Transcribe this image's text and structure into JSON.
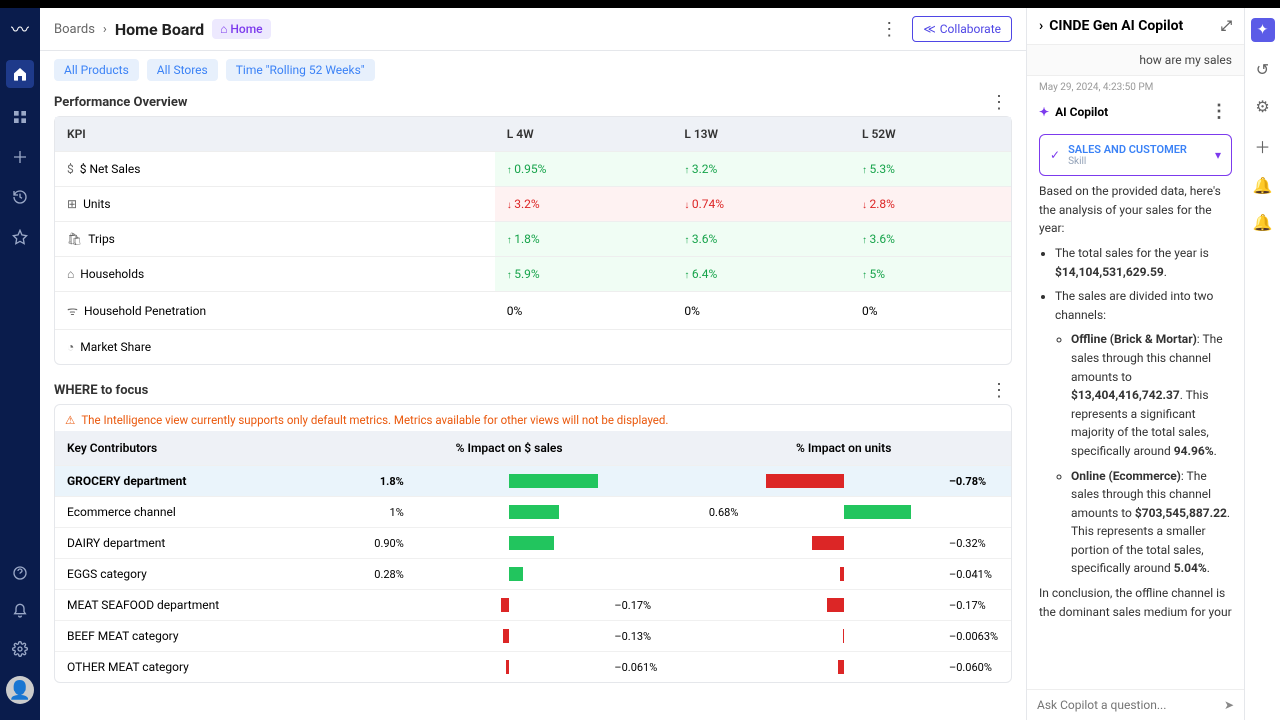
{
  "breadcrumb": {
    "root": "Boards",
    "title": "Home Board",
    "badge": "Home"
  },
  "buttons": {
    "collaborate": "Collaborate"
  },
  "filters": [
    "All Products",
    "All Stores",
    "Time \"Rolling 52 Weeks\""
  ],
  "perf": {
    "title": "Performance Overview",
    "cols": [
      "KPI",
      "L 4W",
      "L 13W",
      "L 52W"
    ],
    "rows": [
      {
        "icon": "$",
        "label": "$ Net Sales",
        "v": [
          "0.95%",
          "3.2%",
          "5.3%"
        ],
        "dir": [
          "up",
          "up",
          "up"
        ]
      },
      {
        "icon": "⊞",
        "label": "Units",
        "v": [
          "3.2%",
          "0.74%",
          "2.8%"
        ],
        "dir": [
          "down",
          "down",
          "down"
        ]
      },
      {
        "icon": "🛍",
        "label": "Trips",
        "v": [
          "1.8%",
          "3.6%",
          "3.6%"
        ],
        "dir": [
          "up",
          "up",
          "up"
        ]
      },
      {
        "icon": "⌂",
        "label": "Households",
        "v": [
          "5.9%",
          "6.4%",
          "5%"
        ],
        "dir": [
          "up",
          "up",
          "up"
        ]
      },
      {
        "icon": "ᯤ",
        "label": "Household Penetration",
        "v": [
          "0%",
          "0%",
          "0%"
        ],
        "dir": [
          "",
          "",
          ""
        ]
      },
      {
        "icon": "◔",
        "label": "Market Share",
        "v": [
          "",
          "",
          ""
        ],
        "dir": [
          "",
          "",
          ""
        ]
      }
    ]
  },
  "focus": {
    "title": "WHERE to focus",
    "warning": "The Intelligence view currently supports only default metrics. Metrics available for other views will not be displayed.",
    "cols": [
      "Key Contributors",
      "% Impact on $ sales",
      "% Impact on units"
    ],
    "max_abs_sales": 2.0,
    "max_abs_units": 1.0,
    "rows": [
      {
        "name": "GROCERY department",
        "sales": 1.8,
        "units": -0.78,
        "hl": true
      },
      {
        "name": "Ecommerce channel",
        "sales": 1.0,
        "units": 0.68
      },
      {
        "name": "DAIRY department",
        "sales": 0.9,
        "units": -0.32
      },
      {
        "name": "EGGS category",
        "sales": 0.28,
        "units": -0.041
      },
      {
        "name": "MEAT SEAFOOD department",
        "sales": -0.17,
        "units": -0.17
      },
      {
        "name": "BEEF MEAT category",
        "sales": -0.13,
        "units": -0.0063
      },
      {
        "name": "OTHER MEAT category",
        "sales": -0.061,
        "units": -0.06
      }
    ]
  },
  "copilot": {
    "title": "CINDE Gen AI Copilot",
    "user_q": "how are my sales",
    "ts": "May 29, 2024, 4:23:50 PM",
    "ai_label": "AI Copilot",
    "skill_title": "SALES AND CUSTOMER",
    "skill_sub": "Skill",
    "intro": "Based on the provided data, here's the analysis of your sales for the year:",
    "total_prefix": "The total sales for the year is ",
    "total_value": "$14,104,531,629.59",
    "channels_intro": "The sales are divided into two channels:",
    "offline_label": "Offline (Brick & Mortar)",
    "offline_text1": ": The sales through this channel amounts to ",
    "offline_value": "$13,404,416,742.37",
    "offline_text2": ". This represents a significant majority of the total sales, specifically around ",
    "offline_pct": "94.96%",
    "online_label": "Online (Ecommerce)",
    "online_text1": ": The sales through this channel amounts to ",
    "online_value": "$703,545,887.22",
    "online_text2": ". This represents a smaller portion of the total sales, specifically around ",
    "online_pct": "5.04%",
    "conclusion": "In conclusion, the offline channel is the dominant sales medium for your",
    "placeholder": "Ask Copilot a question..."
  }
}
